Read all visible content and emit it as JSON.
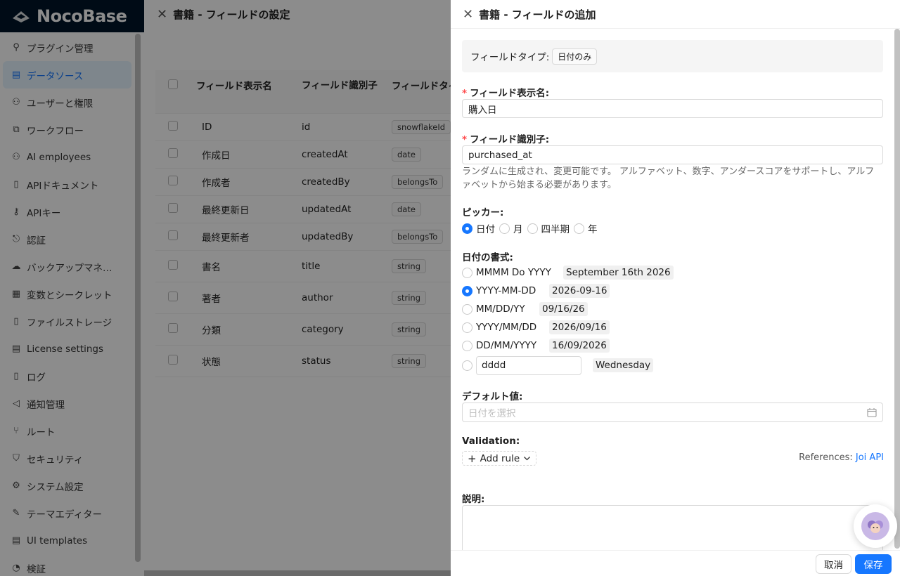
{
  "app": {
    "logo": "NocoBase"
  },
  "sidebar": {
    "items": [
      {
        "label": "プラグイン管理",
        "icon": "plugin-icon"
      },
      {
        "label": "データソース",
        "icon": "database-icon",
        "active": true
      },
      {
        "label": "ユーザーと権限",
        "icon": "users-icon"
      },
      {
        "label": "ワークフロー",
        "icon": "workflow-icon"
      },
      {
        "label": "AI employees",
        "icon": "ai-employees-icon"
      },
      {
        "label": "APIドキュメント",
        "icon": "document-icon"
      },
      {
        "label": "APIキー",
        "icon": "key-icon"
      },
      {
        "label": "認証",
        "icon": "login-icon"
      },
      {
        "label": "バックアップマネ…",
        "icon": "cloud-icon"
      },
      {
        "label": "変数とシークレット",
        "icon": "table-icon"
      },
      {
        "label": "ファイルストレージ",
        "icon": "file-icon"
      },
      {
        "label": "License settings",
        "icon": "license-icon"
      },
      {
        "label": "ログ",
        "icon": "log-icon"
      },
      {
        "label": "通知管理",
        "icon": "notification-icon"
      },
      {
        "label": "ルート",
        "icon": "route-icon"
      },
      {
        "label": "セキュリティ",
        "icon": "shield-icon"
      },
      {
        "label": "システム設定",
        "icon": "settings-icon"
      },
      {
        "label": "テーマエディター",
        "icon": "theme-icon"
      },
      {
        "label": "UI templates",
        "icon": "template-icon"
      },
      {
        "label": "検証",
        "icon": "verify-icon"
      }
    ]
  },
  "bg_drawer": {
    "title": "書籍 - フィールドの設定",
    "columns": [
      "フィールド表示名",
      "フィールド識別子",
      "フィールドタイプ"
    ],
    "rows": [
      {
        "name": "ID",
        "key": "id",
        "type": "snowflakeId"
      },
      {
        "name": "作成日",
        "key": "createdAt",
        "type": "date"
      },
      {
        "name": "作成者",
        "key": "createdBy",
        "type": "belongsTo"
      },
      {
        "name": "最終更新日",
        "key": "updatedAt",
        "type": "date"
      },
      {
        "name": "最終更新者",
        "key": "updatedBy",
        "type": "belongsTo"
      },
      {
        "name": "書名",
        "key": "title",
        "type": "string"
      },
      {
        "name": "著者",
        "key": "author",
        "type": "string"
      },
      {
        "name": "分類",
        "key": "category",
        "type": "string"
      },
      {
        "name": "状態",
        "key": "status",
        "type": "string"
      }
    ]
  },
  "drawer": {
    "title": "書籍 - フィールドの追加",
    "field_type_label": "フィールドタイプ:",
    "field_type_value": "日付のみ",
    "display_name_label": "フィールド表示名",
    "display_name_value": "購入日",
    "identifier_label": "フィールド識別子",
    "identifier_value": "purchased_at",
    "identifier_help": "ランダムに生成され、変更可能です。 アルファベット、数字、アンダースコアをサポートし、アルファベットから始まる必要があります。",
    "picker_label": "ピッカー",
    "picker_options": [
      {
        "label": "日付",
        "checked": true
      },
      {
        "label": "月",
        "checked": false
      },
      {
        "label": "四半期",
        "checked": false
      },
      {
        "label": "年",
        "checked": false
      }
    ],
    "format_label": "日付の書式",
    "formats": [
      {
        "format": "MMMM Do YYYY",
        "preview": "September 16th 2026",
        "checked": false
      },
      {
        "format": "YYYY-MM-DD",
        "preview": "2026-09-16",
        "checked": true
      },
      {
        "format": "MM/DD/YY",
        "preview": "09/16/26",
        "checked": false
      },
      {
        "format": "YYYY/MM/DD",
        "preview": "2026/09/16",
        "checked": false
      },
      {
        "format": "DD/MM/YYYY",
        "preview": "16/09/2026",
        "checked": false
      }
    ],
    "custom_format": {
      "value": "dddd",
      "preview": "Wednesday",
      "checked": false
    },
    "default_label": "デフォルト値",
    "default_placeholder": "日付を選択",
    "validation_label": "Validation",
    "add_rule_label": "Add rule",
    "references_label": "References:",
    "references_link": "Joi API",
    "description_label": "説明",
    "cancel_label": "取消",
    "save_label": "保存"
  },
  "colors": {
    "primary": "#1677ff",
    "required": "#ff4d4f",
    "header_dark": "#001529"
  }
}
